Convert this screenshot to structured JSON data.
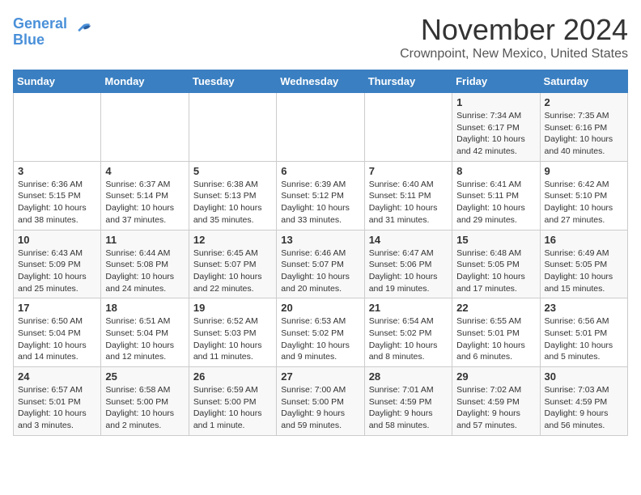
{
  "logo": {
    "line1": "General",
    "line2": "Blue"
  },
  "title": "November 2024",
  "subtitle": "Crownpoint, New Mexico, United States",
  "days_of_week": [
    "Sunday",
    "Monday",
    "Tuesday",
    "Wednesday",
    "Thursday",
    "Friday",
    "Saturday"
  ],
  "weeks": [
    [
      {
        "day": "",
        "info": ""
      },
      {
        "day": "",
        "info": ""
      },
      {
        "day": "",
        "info": ""
      },
      {
        "day": "",
        "info": ""
      },
      {
        "day": "",
        "info": ""
      },
      {
        "day": "1",
        "info": "Sunrise: 7:34 AM\nSunset: 6:17 PM\nDaylight: 10 hours\nand 42 minutes."
      },
      {
        "day": "2",
        "info": "Sunrise: 7:35 AM\nSunset: 6:16 PM\nDaylight: 10 hours\nand 40 minutes."
      }
    ],
    [
      {
        "day": "3",
        "info": "Sunrise: 6:36 AM\nSunset: 5:15 PM\nDaylight: 10 hours\nand 38 minutes."
      },
      {
        "day": "4",
        "info": "Sunrise: 6:37 AM\nSunset: 5:14 PM\nDaylight: 10 hours\nand 37 minutes."
      },
      {
        "day": "5",
        "info": "Sunrise: 6:38 AM\nSunset: 5:13 PM\nDaylight: 10 hours\nand 35 minutes."
      },
      {
        "day": "6",
        "info": "Sunrise: 6:39 AM\nSunset: 5:12 PM\nDaylight: 10 hours\nand 33 minutes."
      },
      {
        "day": "7",
        "info": "Sunrise: 6:40 AM\nSunset: 5:11 PM\nDaylight: 10 hours\nand 31 minutes."
      },
      {
        "day": "8",
        "info": "Sunrise: 6:41 AM\nSunset: 5:11 PM\nDaylight: 10 hours\nand 29 minutes."
      },
      {
        "day": "9",
        "info": "Sunrise: 6:42 AM\nSunset: 5:10 PM\nDaylight: 10 hours\nand 27 minutes."
      }
    ],
    [
      {
        "day": "10",
        "info": "Sunrise: 6:43 AM\nSunset: 5:09 PM\nDaylight: 10 hours\nand 25 minutes."
      },
      {
        "day": "11",
        "info": "Sunrise: 6:44 AM\nSunset: 5:08 PM\nDaylight: 10 hours\nand 24 minutes."
      },
      {
        "day": "12",
        "info": "Sunrise: 6:45 AM\nSunset: 5:07 PM\nDaylight: 10 hours\nand 22 minutes."
      },
      {
        "day": "13",
        "info": "Sunrise: 6:46 AM\nSunset: 5:07 PM\nDaylight: 10 hours\nand 20 minutes."
      },
      {
        "day": "14",
        "info": "Sunrise: 6:47 AM\nSunset: 5:06 PM\nDaylight: 10 hours\nand 19 minutes."
      },
      {
        "day": "15",
        "info": "Sunrise: 6:48 AM\nSunset: 5:05 PM\nDaylight: 10 hours\nand 17 minutes."
      },
      {
        "day": "16",
        "info": "Sunrise: 6:49 AM\nSunset: 5:05 PM\nDaylight: 10 hours\nand 15 minutes."
      }
    ],
    [
      {
        "day": "17",
        "info": "Sunrise: 6:50 AM\nSunset: 5:04 PM\nDaylight: 10 hours\nand 14 minutes."
      },
      {
        "day": "18",
        "info": "Sunrise: 6:51 AM\nSunset: 5:04 PM\nDaylight: 10 hours\nand 12 minutes."
      },
      {
        "day": "19",
        "info": "Sunrise: 6:52 AM\nSunset: 5:03 PM\nDaylight: 10 hours\nand 11 minutes."
      },
      {
        "day": "20",
        "info": "Sunrise: 6:53 AM\nSunset: 5:02 PM\nDaylight: 10 hours\nand 9 minutes."
      },
      {
        "day": "21",
        "info": "Sunrise: 6:54 AM\nSunset: 5:02 PM\nDaylight: 10 hours\nand 8 minutes."
      },
      {
        "day": "22",
        "info": "Sunrise: 6:55 AM\nSunset: 5:01 PM\nDaylight: 10 hours\nand 6 minutes."
      },
      {
        "day": "23",
        "info": "Sunrise: 6:56 AM\nSunset: 5:01 PM\nDaylight: 10 hours\nand 5 minutes."
      }
    ],
    [
      {
        "day": "24",
        "info": "Sunrise: 6:57 AM\nSunset: 5:01 PM\nDaylight: 10 hours\nand 3 minutes."
      },
      {
        "day": "25",
        "info": "Sunrise: 6:58 AM\nSunset: 5:00 PM\nDaylight: 10 hours\nand 2 minutes."
      },
      {
        "day": "26",
        "info": "Sunrise: 6:59 AM\nSunset: 5:00 PM\nDaylight: 10 hours\nand 1 minute."
      },
      {
        "day": "27",
        "info": "Sunrise: 7:00 AM\nSunset: 5:00 PM\nDaylight: 9 hours\nand 59 minutes."
      },
      {
        "day": "28",
        "info": "Sunrise: 7:01 AM\nSunset: 4:59 PM\nDaylight: 9 hours\nand 58 minutes."
      },
      {
        "day": "29",
        "info": "Sunrise: 7:02 AM\nSunset: 4:59 PM\nDaylight: 9 hours\nand 57 minutes."
      },
      {
        "day": "30",
        "info": "Sunrise: 7:03 AM\nSunset: 4:59 PM\nDaylight: 9 hours\nand 56 minutes."
      }
    ]
  ]
}
